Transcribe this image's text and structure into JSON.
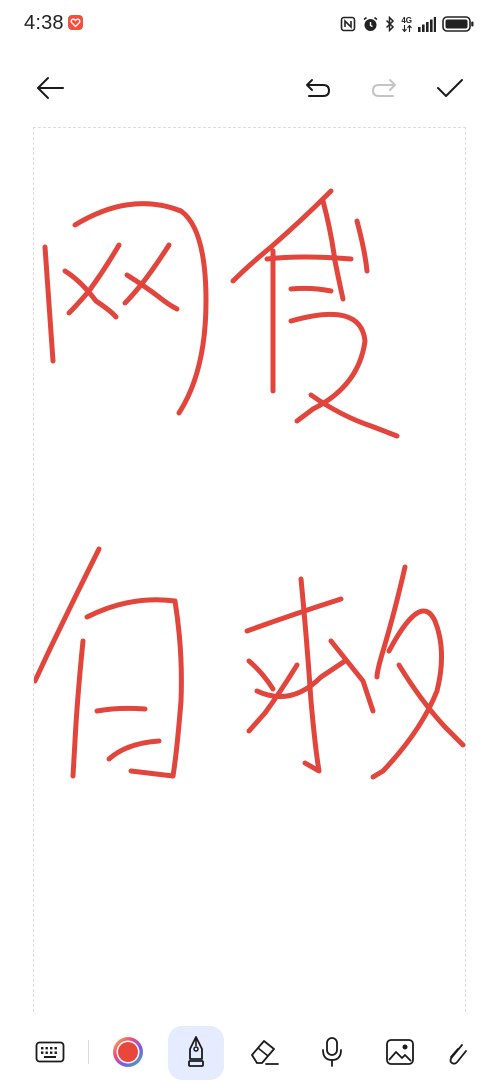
{
  "status_bar": {
    "time": "4:38",
    "network": "4G",
    "icons": [
      "notification-app-icon",
      "nfc-icon",
      "alarm-icon",
      "bluetooth-icon",
      "signal-icon",
      "battery-icon"
    ]
  },
  "toolbar": {
    "icons": [
      "back-arrow-icon",
      "undo-icon",
      "redo-icon",
      "check-icon"
    ],
    "redo_enabled": false
  },
  "canvas": {
    "ink_color": "#e2453b",
    "handwriting": "网费自救"
  },
  "tools": {
    "icons": [
      "keyboard-icon",
      "color-picker-icon",
      "pen-icon",
      "eraser-icon",
      "microphone-icon",
      "image-icon",
      "link-icon"
    ],
    "active_tool": "pen-icon",
    "active_color": "#e8483b"
  },
  "colors": {
    "accent_bg": "#e6ecff",
    "ink": "#e2453b"
  }
}
